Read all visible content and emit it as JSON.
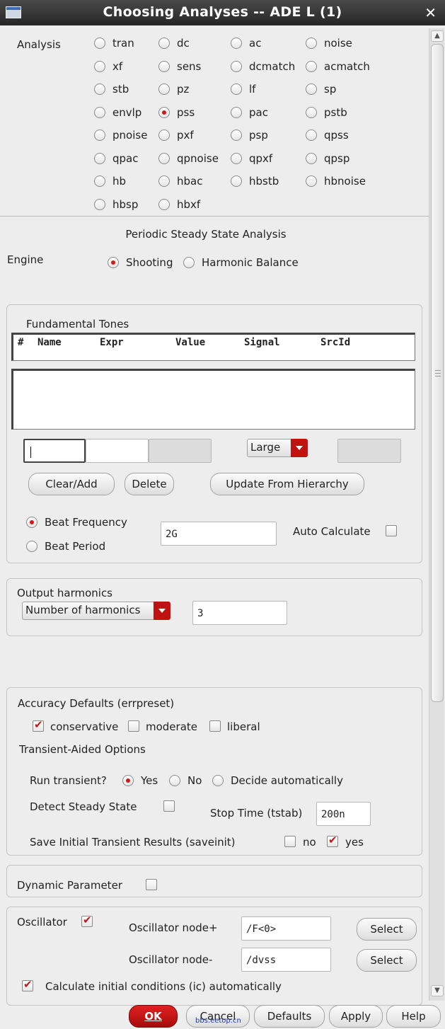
{
  "window": {
    "title": "Choosing Analyses -- ADE L (1)"
  },
  "analysis": {
    "label": "Analysis",
    "types": [
      [
        "tran",
        "dc",
        "ac",
        "noise"
      ],
      [
        "xf",
        "sens",
        "dcmatch",
        "acmatch"
      ],
      [
        "stb",
        "pz",
        "lf",
        "sp"
      ],
      [
        "envlp",
        "pss",
        "pac",
        "pstb"
      ],
      [
        "pnoise",
        "pxf",
        "psp",
        "qpss"
      ],
      [
        "qpac",
        "qpnoise",
        "qpxf",
        "qpsp"
      ],
      [
        "hb",
        "hbac",
        "hbstb",
        "hbnoise"
      ],
      [
        "hbsp",
        "hbxf"
      ]
    ],
    "selected": "pss"
  },
  "section_title": "Periodic Steady State Analysis",
  "engine": {
    "label": "Engine",
    "option1": "Shooting",
    "option2": "Harmonic Balance",
    "selected": "Shooting"
  },
  "tones": {
    "title": "Fundamental Tones",
    "columns": [
      "#",
      "Name",
      "Expr",
      "Value",
      "Signal",
      "SrcId"
    ],
    "rows": [],
    "size_value": "Large",
    "clear_add": "Clear/Add",
    "delete": "Delete",
    "update": "Update From Hierarchy",
    "beat_frequency": "Beat Frequency",
    "beat_period": "Beat Period",
    "beat_value": "2G",
    "auto_calculate": "Auto Calculate"
  },
  "output_harmonics": {
    "title": "Output harmonics",
    "mode": "Number of harmonics",
    "value": "3"
  },
  "accuracy": {
    "title": "Accuracy Defaults (errpreset)",
    "conservative": "conservative",
    "moderate": "moderate",
    "liberal": "liberal",
    "selected": "conservative"
  },
  "transient": {
    "title": "Transient-Aided Options",
    "run_label": "Run transient?",
    "yes": "Yes",
    "no": "No",
    "auto": "Decide automatically",
    "run_selected": "Yes",
    "detect": "Detect Steady State",
    "stop_time_label": "Stop Time (tstab)",
    "stop_time": "200n",
    "save_init": "Save Initial Transient Results (saveinit)",
    "save_no": "no",
    "save_yes": "yes"
  },
  "dynamic": {
    "label": "Dynamic Parameter"
  },
  "oscillator": {
    "label": "Oscillator",
    "node_plus_label": "Oscillator node+",
    "node_plus": "/F<0>",
    "node_minus_label": "Oscillator node-",
    "node_minus": "/dvss",
    "select": "Select",
    "calc_ic": "Calculate initial conditions (ic) automatically"
  },
  "buttons": {
    "ok": "OK",
    "cancel": "Cancel",
    "defaults": "Defaults",
    "apply": "Apply",
    "help": "Help"
  },
  "watermark": "bbs.eetop.cn"
}
